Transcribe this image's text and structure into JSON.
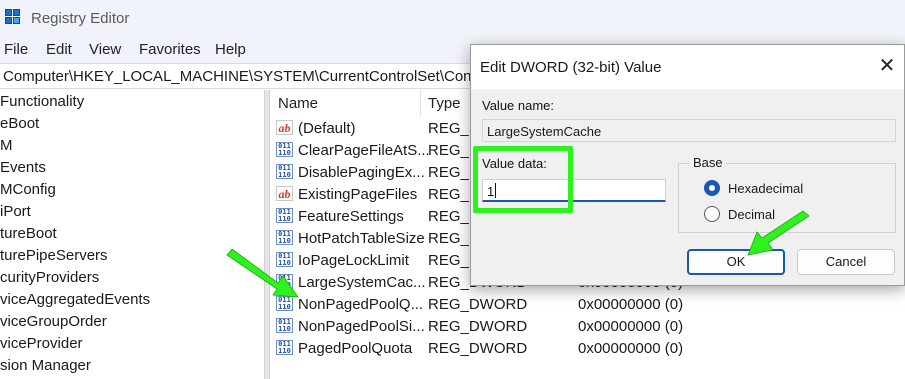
{
  "window": {
    "title": "Registry Editor",
    "menu": [
      "File",
      "Edit",
      "View",
      "Favorites",
      "Help"
    ],
    "address": "Computer\\HKEY_LOCAL_MACHINE\\SYSTEM\\CurrentControlSet\\Control"
  },
  "tree": {
    "items": [
      "Functionality",
      "eBoot",
      "M",
      "Events",
      "MConfig",
      "iPort",
      "tureBoot",
      "turePipeServers",
      "curityProviders",
      "viceAggregatedEvents",
      "viceGroupOrder",
      "viceProvider",
      "sion Manager"
    ]
  },
  "list": {
    "columns": {
      "name": "Name",
      "type": "Type"
    },
    "rows": [
      {
        "icon": "string-value-icon",
        "name": "(Default)",
        "type": "REG_S",
        "data": ""
      },
      {
        "icon": "binary-value-icon",
        "name": "ClearPageFileAtS...",
        "type": "REG_D",
        "data": ""
      },
      {
        "icon": "binary-value-icon",
        "name": "DisablePagingEx...",
        "type": "REG_D",
        "data": ""
      },
      {
        "icon": "string-value-icon",
        "name": "ExistingPageFiles",
        "type": "REG_M",
        "data": ""
      },
      {
        "icon": "binary-value-icon",
        "name": "FeatureSettings",
        "type": "REG_D",
        "data": ""
      },
      {
        "icon": "binary-value-icon",
        "name": "HotPatchTableSize",
        "type": "REG_D",
        "data": ""
      },
      {
        "icon": "binary-value-icon",
        "name": "IoPageLockLimit",
        "type": "REG_D",
        "data": ""
      },
      {
        "icon": "binary-value-icon",
        "name": "LargeSystemCac...",
        "type": "REG_DWORD",
        "data": "0x00000000 (0)"
      },
      {
        "icon": "binary-value-icon",
        "name": "NonPagedPoolQ...",
        "type": "REG_DWORD",
        "data": "0x00000000 (0)"
      },
      {
        "icon": "binary-value-icon",
        "name": "NonPagedPoolSi...",
        "type": "REG_DWORD",
        "data": "0x00000000 (0)"
      },
      {
        "icon": "binary-value-icon",
        "name": "PagedPoolQuota",
        "type": "REG_DWORD",
        "data": "0x00000000 (0)"
      }
    ]
  },
  "dialog": {
    "title": "Edit DWORD (32-bit) Value",
    "value_name_label": "Value name:",
    "value_name": "LargeSystemCache",
    "value_data_label": "Value data:",
    "value_data": "1",
    "base_label": "Base",
    "base_options": [
      "Hexadecimal",
      "Decimal"
    ],
    "base_selected": "Hexadecimal",
    "ok_label": "OK",
    "cancel_label": "Cancel",
    "close_glyph": "✕"
  },
  "colors": {
    "annotation": "#2df21d",
    "accent": "#1a56b8"
  }
}
